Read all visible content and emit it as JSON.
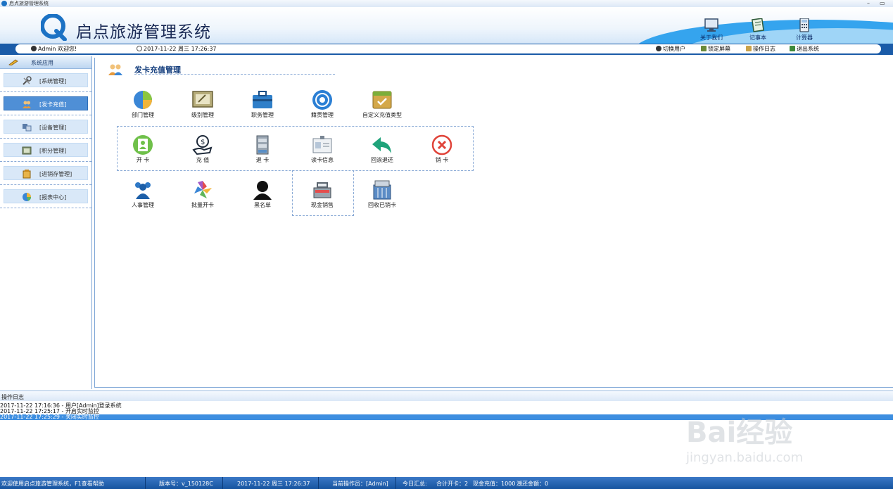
{
  "window": {
    "title": "启点旅游管理系统",
    "controls": [
      "–",
      "▭"
    ]
  },
  "header": {
    "app_name": "启点旅游管理系统",
    "tools": [
      {
        "label": "关于我们",
        "icon": "monitor-icon"
      },
      {
        "label": "记事本",
        "icon": "notebook-icon"
      },
      {
        "label": "计算器",
        "icon": "calculator-icon"
      }
    ]
  },
  "infobar": {
    "user": "Admin 欢迎您!",
    "datetime": "2017-11-22 周三 17:26:37",
    "actions": [
      "切换用户",
      "锁定屏幕",
      "操作日志",
      "退出系统"
    ]
  },
  "sidebar": {
    "header": "系统应用",
    "items": [
      {
        "label": "[系统管理]",
        "icon": "tools-icon",
        "active": false
      },
      {
        "label": "[发卡充值]",
        "icon": "users-icon",
        "active": true
      },
      {
        "label": "[设备管理]",
        "icon": "device-icon",
        "active": false
      },
      {
        "label": "[积分管理]",
        "icon": "points-icon",
        "active": false
      },
      {
        "label": "[进销存管理]",
        "icon": "inventory-icon",
        "active": false
      },
      {
        "label": "[报表中心]",
        "icon": "pie-chart-icon",
        "active": false
      }
    ]
  },
  "main": {
    "section_title": "发卡充值管理",
    "functions": [
      {
        "label": "部门管理",
        "icon": "department-icon"
      },
      {
        "label": "级别管理",
        "icon": "level-icon"
      },
      {
        "label": "职务管理",
        "icon": "briefcase-icon"
      },
      {
        "label": "籍贯管理",
        "icon": "hometown-icon"
      },
      {
        "label": "自定义充值类型",
        "icon": "custom-recharge-icon"
      },
      {
        "label": "开 卡",
        "icon": "open-card-icon"
      },
      {
        "label": "充 值",
        "icon": "recharge-icon"
      },
      {
        "label": "退 卡",
        "icon": "return-card-icon"
      },
      {
        "label": "读卡信息",
        "icon": "read-card-icon"
      },
      {
        "label": "回滚退还",
        "icon": "rollback-icon"
      },
      {
        "label": "销 卡",
        "icon": "cancel-card-icon"
      },
      {
        "label": "人事管理",
        "icon": "personnel-icon"
      },
      {
        "label": "批量开卡",
        "icon": "batch-card-icon"
      },
      {
        "label": "黑名单",
        "icon": "blacklist-icon"
      },
      {
        "label": "现金销售",
        "icon": "cash-register-icon"
      },
      {
        "label": "回收已销卡",
        "icon": "recycle-card-icon"
      }
    ]
  },
  "log": {
    "header": "操作日志",
    "lines": [
      "2017-11-22 17:16:36 - 用户[Admin]登录系统",
      "2017-11-22 17:25:17 - 开启实时监控",
      "2017-11-22 17:25:29 - 关闭实时监控"
    ]
  },
  "status": {
    "welcome": "欢迎使用启点旅游管理系统，F1查看帮助",
    "version": "版本号：v_150128C",
    "datetime": "2017-11-22 周三 17:26:37",
    "operator": "当前操作员：[Admin]",
    "summary_label": "今日汇总:",
    "open_cards": "合计开卡：2",
    "cash_recharge": "现金充值：1000",
    "refund": "潮还金额：0"
  },
  "watermark": {
    "brand": "Bai经验",
    "url": "jingyan.baidu.com"
  },
  "colors": {
    "accent": "#1a5ba8",
    "active_nav": "#4f8fd6",
    "title": "#123c7c"
  }
}
